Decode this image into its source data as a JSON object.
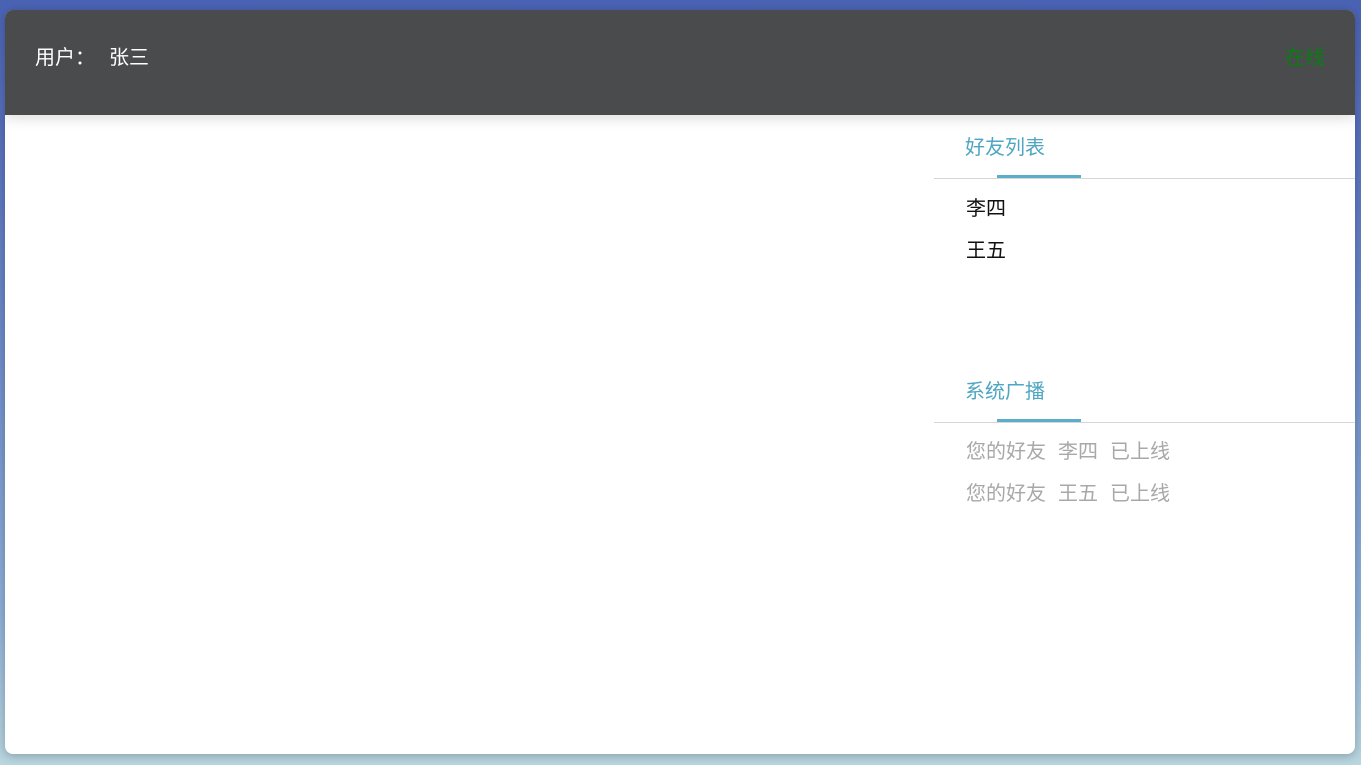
{
  "header": {
    "user_prefix": "用户：",
    "user_name": "张三",
    "status": "在线"
  },
  "friends": {
    "tab_label": "好友列表",
    "items": [
      {
        "name": "李四"
      },
      {
        "name": "王五"
      }
    ]
  },
  "broadcast": {
    "tab_label": "系统广播",
    "items": [
      {
        "prefix": "您的好友",
        "name": "李四",
        "suffix": "已上线"
      },
      {
        "prefix": "您的好友",
        "name": "王五",
        "suffix": "已上线"
      }
    ]
  },
  "colors": {
    "header_bg": "#4a4b4d",
    "status_online": "#0a7d12",
    "tab_accent": "#4fa6c2",
    "broadcast_text": "#a8a8a8"
  }
}
